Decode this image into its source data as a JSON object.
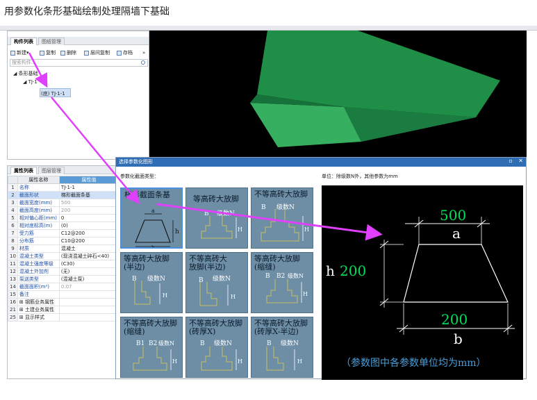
{
  "page_title": "用参数化条形基础绘制处理隔墙下基础",
  "component_panel": {
    "tabs": [
      "构件列表",
      "图纸管理"
    ],
    "toolbar": [
      "新建",
      "复制",
      "删除",
      "层间复制",
      "存档"
    ],
    "search_placeholder": "搜索构件...",
    "tree": [
      "条形基础",
      "TJ-1",
      "(底) TJ-1-1"
    ]
  },
  "property_panel": {
    "tabs": [
      "属性列表",
      "图层管理"
    ],
    "headers": [
      "属性名称",
      "属性值"
    ],
    "rows": [
      {
        "no": "1",
        "name": "名称",
        "value": "TJ-1-1"
      },
      {
        "no": "2",
        "name": "截面形状",
        "value": "梯形截面条基"
      },
      {
        "no": "3",
        "name": "截面宽度(mm)",
        "value": "500"
      },
      {
        "no": "4",
        "name": "截面高度(mm)",
        "value": "200"
      },
      {
        "no": "5",
        "name": "相对偏心距(mm)",
        "value": "0"
      },
      {
        "no": "6",
        "name": "相对底标高(m)",
        "value": "(0)"
      },
      {
        "no": "7",
        "name": "受力筋",
        "value": "C12@200"
      },
      {
        "no": "8",
        "name": "分布筋",
        "value": "C10@200"
      },
      {
        "no": "9",
        "name": "材质",
        "value": "混凝土"
      },
      {
        "no": "10",
        "name": "混凝土类型",
        "value": "(现浇混凝土碎石<40)"
      },
      {
        "no": "11",
        "name": "混凝土强度等级",
        "value": "(C30)"
      },
      {
        "no": "12",
        "name": "混凝土外加剂",
        "value": "(无)"
      },
      {
        "no": "13",
        "name": "泵送类型",
        "value": "(混凝土泵)"
      },
      {
        "no": "14",
        "name": "截面面积(m²)",
        "value": "0.07"
      },
      {
        "no": "15",
        "name": "备注",
        "value": ""
      },
      {
        "no": "16",
        "name": "钢筋业务属性",
        "value": ""
      },
      {
        "no": "21",
        "name": "土建业务属性",
        "value": ""
      },
      {
        "no": "25",
        "name": "显示样式",
        "value": ""
      }
    ]
  },
  "dialog": {
    "title": "选择参数化图形",
    "subtitle": "参数化截面类型：",
    "unit_note": "单位：除级数N外，其他参数为mm",
    "shapes": [
      "梯形截面条基",
      "等高砖大放脚",
      "不等高砖大放脚",
      "等高砖大放脚\n(半边)",
      "不等高砖大\n放脚(半边)",
      "等高砖大放脚\n(缩缝)",
      "不等高砖大放脚\n(缩缝)",
      "不等高砖大放脚\n(砖厚X)",
      "不等高砖大放脚\n(砖厚X-半边)"
    ],
    "preview": {
      "top_value": "500",
      "top_label": "a",
      "height_label": "h",
      "height_value": "200",
      "bottom_value": "200",
      "bottom_label": "b",
      "note": "（参数图中各参数单位均为mm）"
    }
  },
  "colors": {
    "accent": "#2f6db5",
    "preview_dim": "#00e05a",
    "arrow": "#e040fb",
    "beam": "#1e8a45"
  }
}
